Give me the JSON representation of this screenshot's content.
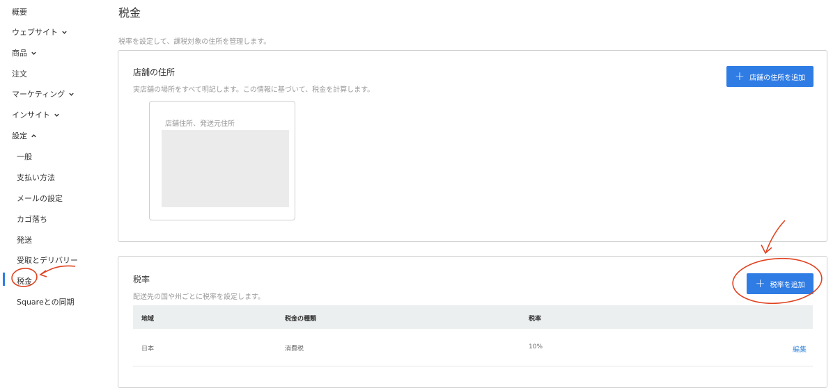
{
  "sidebar": {
    "items": [
      {
        "label": "概要"
      },
      {
        "label": "ウェブサイト",
        "chevron": "down"
      },
      {
        "label": "商品",
        "chevron": "down"
      },
      {
        "label": "注文"
      },
      {
        "label": "マーケティング",
        "chevron": "down"
      },
      {
        "label": "インサイト",
        "chevron": "down"
      },
      {
        "label": "設定",
        "chevron": "up"
      }
    ],
    "settings_items": [
      {
        "label": "一般"
      },
      {
        "label": "支払い方法"
      },
      {
        "label": "メールの設定"
      },
      {
        "label": "カゴ落ち"
      },
      {
        "label": "発送"
      },
      {
        "label": "受取とデリバリー"
      },
      {
        "label": "税金",
        "active": true
      },
      {
        "label": "Squareとの同期"
      }
    ]
  },
  "page": {
    "title": "税金",
    "description": "税率を設定して、課税対象の住所を管理します。"
  },
  "store_address": {
    "title": "店舗の住所",
    "description": "実店舗の場所をすべて明記します。この情報に基づいて、税金を計算します。",
    "add_button": "店舗の住所を追加",
    "box_label": "店舗住所、発送元住所"
  },
  "tax_rate": {
    "title": "税率",
    "description": "配送先の国や州ごとに税率を設定します。",
    "add_button": "税率を追加",
    "columns": [
      "地域",
      "税金の種類",
      "税率"
    ],
    "rows": [
      {
        "region": "日本",
        "type": "消費税",
        "rate": "10%",
        "action": "編集"
      }
    ]
  },
  "colors": {
    "accent": "#2f7ce5",
    "annotation": "#e0421f",
    "link": "#3f8ddb"
  },
  "icons": {
    "chevron_down": "chevron-down-icon",
    "chevron_up": "chevron-up-icon",
    "plus": "plus-icon"
  }
}
